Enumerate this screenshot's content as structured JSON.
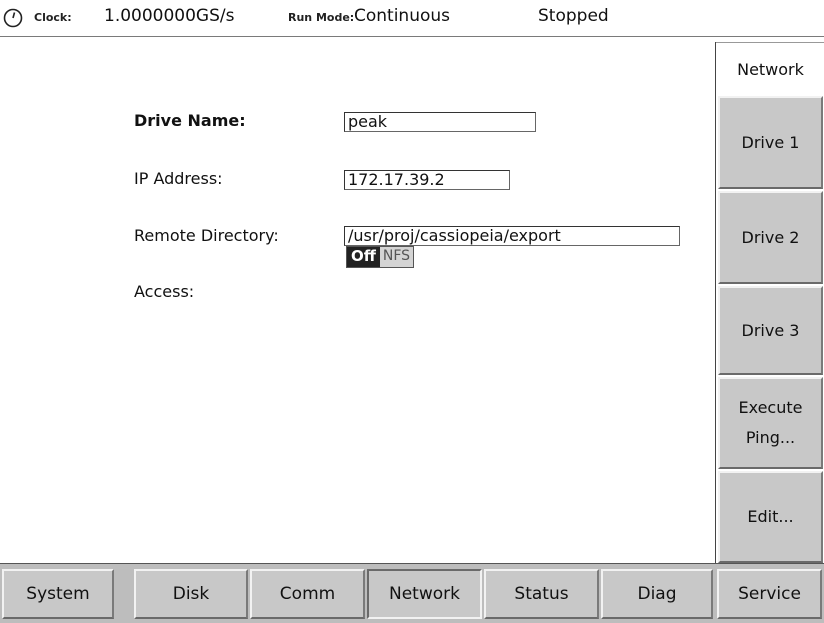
{
  "status_bar": {
    "icon": "clock-icon",
    "clock_label": "Clock:",
    "clock_value": "1.0000000GS/s",
    "run_mode_label": "Run Mode:",
    "run_mode_value": "Continuous",
    "run_state": "Stopped"
  },
  "form": {
    "drive_name_label": "Drive Name:",
    "drive_name_value": "peak",
    "ip_address_label": "IP Address:",
    "ip_address_value": "172.17.39.2",
    "remote_directory_label": "Remote Directory:",
    "remote_directory_value": "/usr/proj/cassiopeia/export",
    "access_label": "Access:",
    "access_options": [
      "Off",
      "NFS"
    ],
    "access_selected": "Off"
  },
  "side_menu": {
    "header": "Network",
    "buttons": [
      {
        "line1": "Drive 1",
        "line2": ""
      },
      {
        "line1": "Drive 2",
        "line2": ""
      },
      {
        "line1": "Drive 3",
        "line2": ""
      },
      {
        "line1": "Execute",
        "line2": "Ping..."
      },
      {
        "line1": "Edit...",
        "line2": ""
      }
    ]
  },
  "tabs": [
    {
      "label": "System"
    },
    {
      "label": "Disk"
    },
    {
      "label": "Comm"
    },
    {
      "label": "Network"
    },
    {
      "label": "Status"
    },
    {
      "label": "Diag"
    },
    {
      "label": "Service"
    }
  ],
  "active_tab": "Network",
  "colors": {
    "button_face": "#c8c8c8",
    "toggle_selected": "#222222",
    "background": "#ffffff"
  }
}
